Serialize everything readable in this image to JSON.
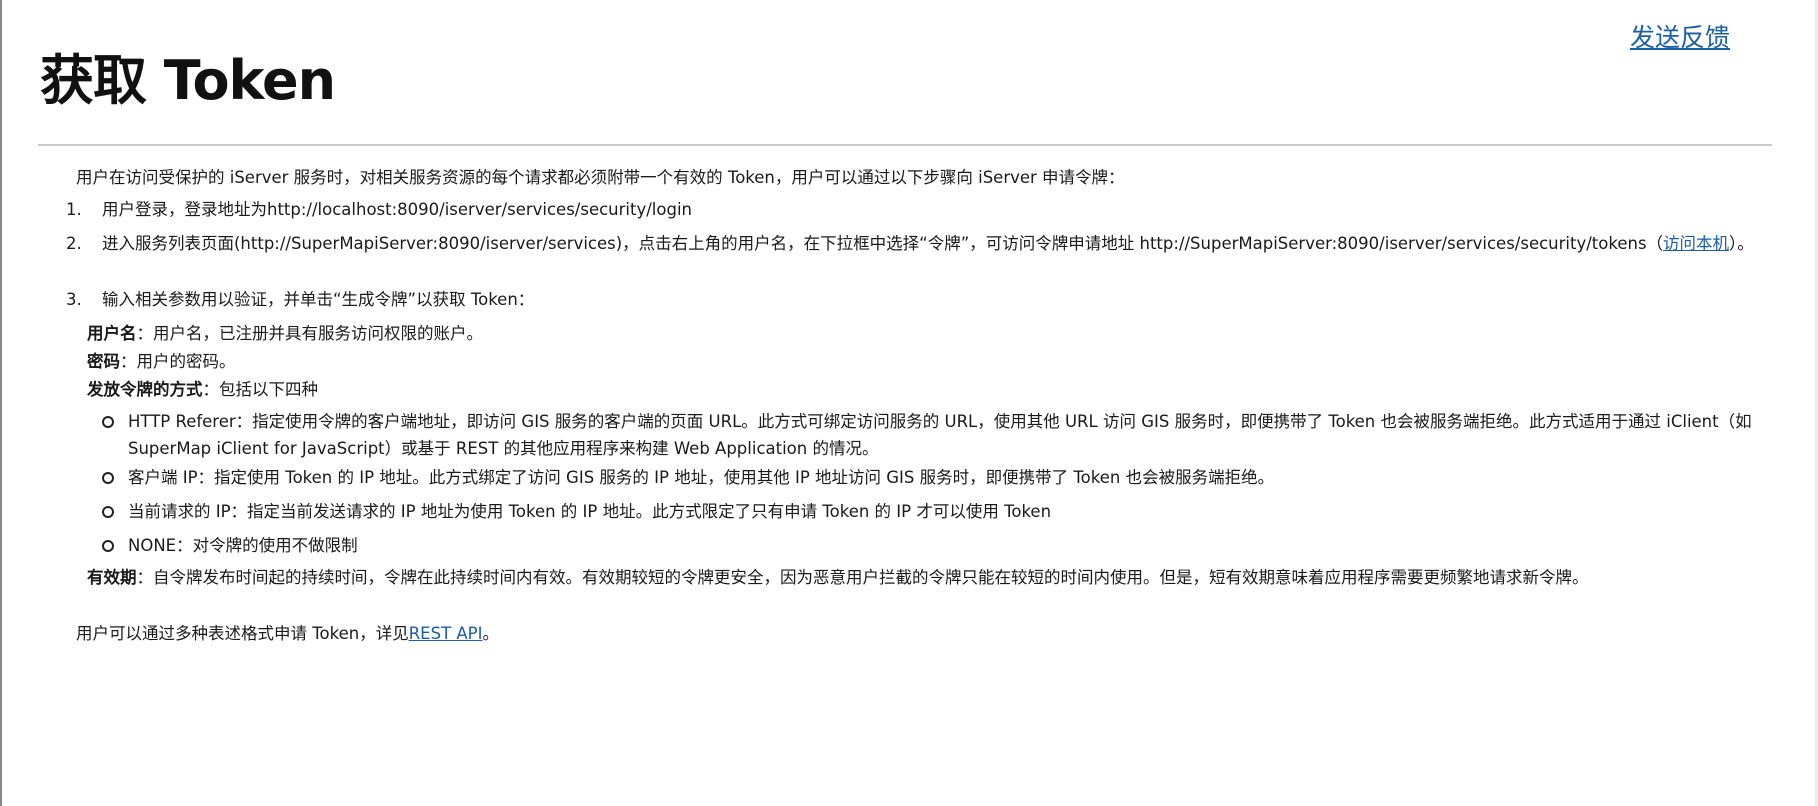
{
  "header": {
    "feedback_label": "发送反馈",
    "title": "获取 Token"
  },
  "intro": "用户在访问受保护的 iServer 服务时，对相关服务资源的每个请求都必须附带一个有效的 Token，用户可以通过以下步骤向 iServer 申请令牌：",
  "steps": [
    {
      "num": "1.",
      "text": "用户登录，登录地址为http://localhost:8090/iserver/services/security/login"
    },
    {
      "num": "2.",
      "text": "进入服务列表页面(http://SuperMapiServer:8090/iserver/services)，点击右上角的用户名，在下拉框中选择“令牌”，可访问令牌申请地址 http://SuperMapiServer:8090/iserver/services/security/tokens（",
      "link": "访问本机",
      "suffix": "）。"
    },
    {
      "num": "3.",
      "text": "输入相关参数用以验证，并单击“生成令牌”以获取 Token："
    }
  ],
  "params": {
    "username_label": "用户名",
    "username_desc": "：用户名，已注册并具有服务访问权限的账户。",
    "password_label": "密码",
    "password_desc": "：用户的密码。",
    "issue_label": "发放令牌的方式",
    "issue_desc": "：包括以下四种",
    "expiry_label": "有效期",
    "expiry_desc": "：自令牌发布时间起的持续时间，令牌在此持续时间内有效。有效期较短的令牌更安全，因为恶意用户拦截的令牌只能在较短的时间内使用。但是，短有效期意味着应用程序需要更频繁地请求新令牌。"
  },
  "issue_methods": [
    "HTTP Referer：指定使用令牌的客户端地址，即访问 GIS 服务的客户端的页面 URL。此方式可绑定访问服务的 URL，使用其他 URL 访问 GIS 服务时，即便携带了 Token 也会被服务端拒绝。此方式适用于通过 iClient（如 SuperMap iClient for JavaScript）或基于 REST 的其他应用程序来构建 Web Application 的情况。",
    "客户端 IP：指定使用 Token 的 IP 地址。此方式绑定了访问 GIS 服务的 IP 地址，使用其他 IP 地址访问 GIS 服务时，即便携带了 Token 也会被服务端拒绝。",
    "当前请求的 IP：指定当前发送请求的 IP 地址为使用 Token 的 IP 地址。此方式限定了只有申请 Token 的 IP 才可以使用 Token",
    "NONE：对令牌的使用不做限制"
  ],
  "footer": {
    "text": "用户可以通过多种表述格式申请 Token，详见",
    "link": "REST API",
    "suffix": "。"
  }
}
